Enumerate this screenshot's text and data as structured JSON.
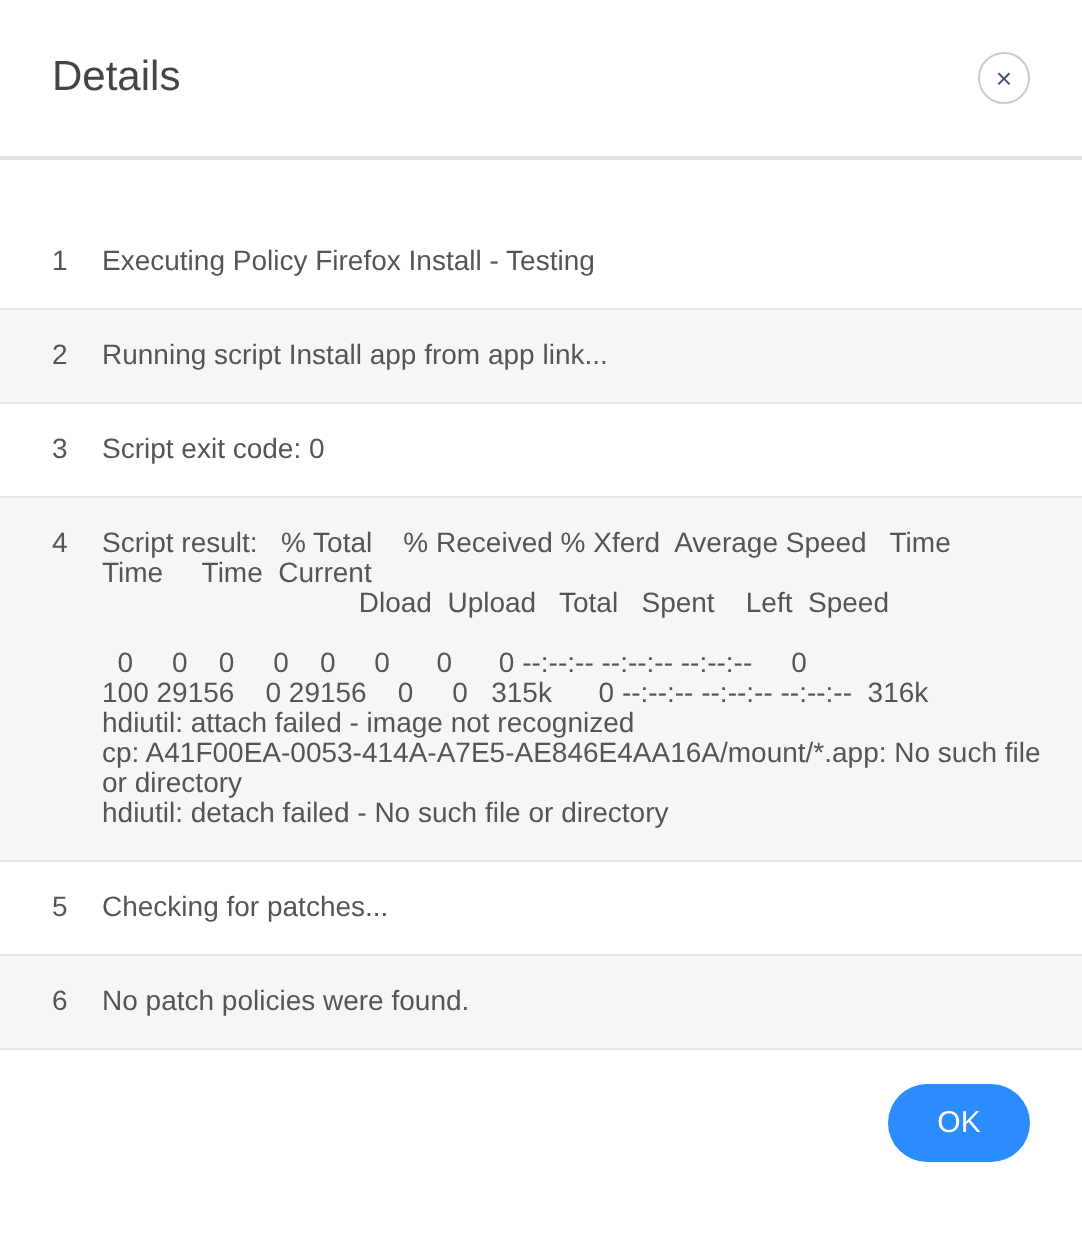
{
  "dialog": {
    "title": "Details",
    "close_icon": "×"
  },
  "steps": [
    {
      "number": "1",
      "message": "Executing Policy Firefox Install - Testing"
    },
    {
      "number": "2",
      "message": "Running script Install app from app link..."
    },
    {
      "number": "3",
      "message": "Script exit code: 0"
    },
    {
      "number": "4",
      "message": "Script result:   % Total    % Received % Xferd  Average Speed   Time    Time     Time  Current\n                                 Dload  Upload   Total   Spent    Left  Speed\n\n  0     0    0     0    0     0      0      0 --:--:-- --:--:-- --:--:--     0\n100 29156    0 29156    0     0   315k      0 --:--:-- --:--:-- --:--:--  316k\nhdiutil: attach failed - image not recognized\ncp: A41F00EA-0053-414A-A7E5-AE846E4AA16A/mount/*.app: No such file or directory\nhdiutil: detach failed - No such file or directory"
    },
    {
      "number": "5",
      "message": "Checking for patches..."
    },
    {
      "number": "6",
      "message": "No patch policies were found."
    }
  ],
  "buttons": [
    "OK"
  ]
}
